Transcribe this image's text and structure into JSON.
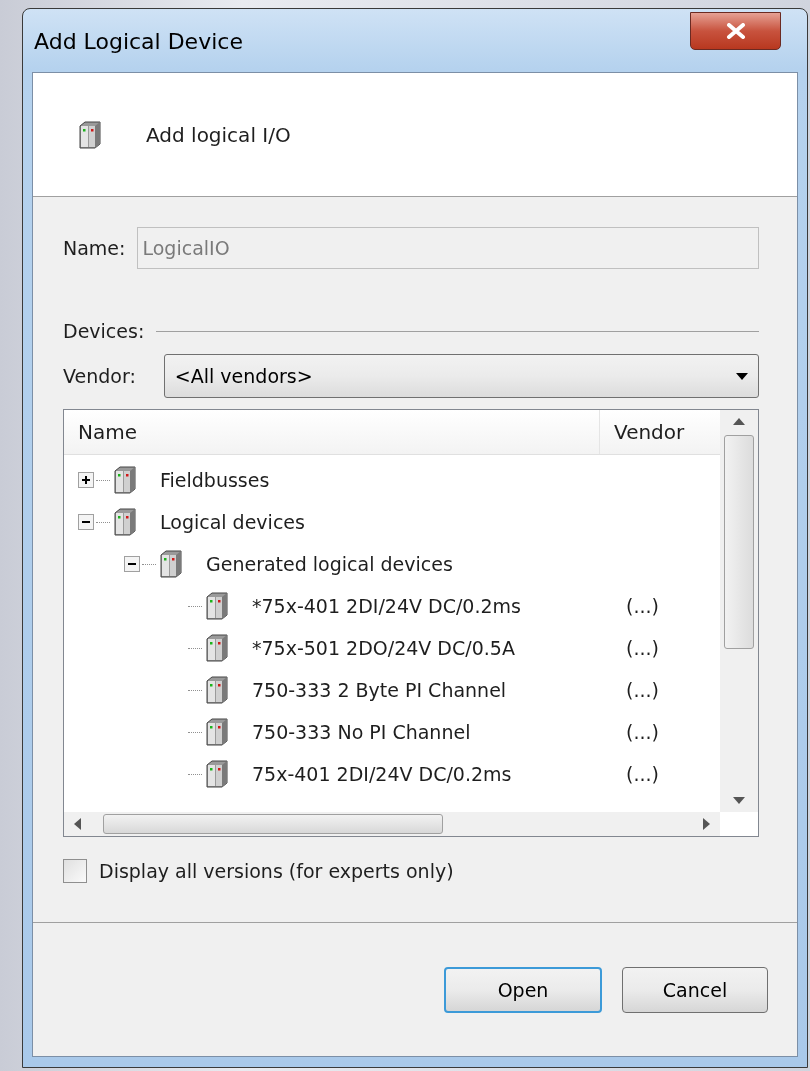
{
  "window": {
    "title": "Add Logical Device"
  },
  "header": {
    "title": "Add logical I/O"
  },
  "name_field": {
    "label": "Name:",
    "value": "LogicalIO",
    "disabled": true
  },
  "devices_label": "Devices:",
  "vendor": {
    "label": "Vendor:",
    "value": "<All vendors>"
  },
  "tree": {
    "columns": [
      "Name",
      "Vendor"
    ],
    "items": [
      {
        "name": "Fieldbusses",
        "expanded": false
      },
      {
        "name": "Logical devices",
        "expanded": true,
        "children": [
          {
            "name": "Generated logical devices",
            "expanded": true,
            "children": [
              {
                "name": "*75x-401 2DI/24V DC/0.2ms",
                "vendor": "(...)"
              },
              {
                "name": "*75x-501 2DO/24V DC/0.5A",
                "vendor": "(...)"
              },
              {
                "name": "750-333 2 Byte PI Channel",
                "vendor": "(...)"
              },
              {
                "name": "750-333 No PI Channel",
                "vendor": "(...)"
              },
              {
                "name": "75x-401 2DI/24V DC/0.2ms",
                "vendor": "(...)"
              }
            ]
          }
        ]
      }
    ]
  },
  "display_all_versions": {
    "label": "Display all versions (for experts only)",
    "checked": false
  },
  "buttons": [
    {
      "label": "Open",
      "default": true
    },
    {
      "label": "Cancel",
      "default": false
    }
  ]
}
